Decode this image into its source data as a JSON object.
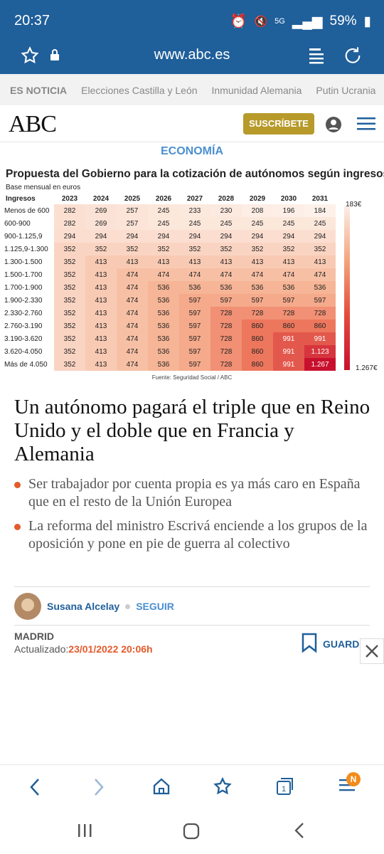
{
  "status_bar": {
    "time": "20:37",
    "battery": "59%",
    "network": "5G"
  },
  "browser": {
    "url": "www.abc.es"
  },
  "topics": [
    "ES NOTICIA",
    "Elecciones Castilla y León",
    "Inmunidad Alemania",
    "Putin Ucrania"
  ],
  "header": {
    "logo": "ABC",
    "subscribe_label": "SUSCRÍBETE"
  },
  "section": "ECONOMÍA",
  "chart_data": {
    "type": "table",
    "title": "Propuesta del Gobierno para la cotización de autónomos según ingresos",
    "subtitle": "Base mensual en euros",
    "row_header": "Ingresos",
    "columns": [
      "2023",
      "2024",
      "2025",
      "2026",
      "2027",
      "2028",
      "2029",
      "2030",
      "2031"
    ],
    "rows": [
      {
        "label": "Menos de 600",
        "values": [
          "282",
          "269",
          "257",
          "245",
          "233",
          "230",
          "208",
          "196",
          "184"
        ]
      },
      {
        "label": "600-900",
        "values": [
          "282",
          "269",
          "257",
          "245",
          "245",
          "245",
          "245",
          "245",
          "245"
        ]
      },
      {
        "label": "900-1.125,9",
        "values": [
          "294",
          "294",
          "294",
          "294",
          "294",
          "294",
          "294",
          "294",
          "294"
        ]
      },
      {
        "label": "1.125,9-1.300",
        "values": [
          "352",
          "352",
          "352",
          "352",
          "352",
          "352",
          "352",
          "352",
          "352"
        ]
      },
      {
        "label": "1.300-1.500",
        "values": [
          "352",
          "413",
          "413",
          "413",
          "413",
          "413",
          "413",
          "413",
          "413"
        ]
      },
      {
        "label": "1.500-1.700",
        "values": [
          "352",
          "413",
          "474",
          "474",
          "474",
          "474",
          "474",
          "474",
          "474"
        ]
      },
      {
        "label": "1.700-1.900",
        "values": [
          "352",
          "413",
          "474",
          "536",
          "536",
          "536",
          "536",
          "536",
          "536"
        ]
      },
      {
        "label": "1.900-2.330",
        "values": [
          "352",
          "413",
          "474",
          "536",
          "597",
          "597",
          "597",
          "597",
          "597"
        ]
      },
      {
        "label": "2.330-2.760",
        "values": [
          "352",
          "413",
          "474",
          "536",
          "597",
          "728",
          "728",
          "728",
          "728"
        ]
      },
      {
        "label": "2.760-3.190",
        "values": [
          "352",
          "413",
          "474",
          "536",
          "597",
          "728",
          "860",
          "860",
          "860"
        ]
      },
      {
        "label": "3.190-3.620",
        "values": [
          "352",
          "413",
          "474",
          "536",
          "597",
          "728",
          "860",
          "991",
          "991"
        ]
      },
      {
        "label": "3.620-4.050",
        "values": [
          "352",
          "413",
          "474",
          "536",
          "597",
          "728",
          "860",
          "991",
          "1.123"
        ]
      },
      {
        "label": "Más de 4.050",
        "values": [
          "352",
          "413",
          "474",
          "536",
          "597",
          "728",
          "860",
          "991",
          "1.267"
        ]
      }
    ],
    "legend_min": "183€",
    "legend_max": "1.267€",
    "source": "Fuente: Seguridad Social / ABC",
    "colors": {
      "low": "#fdf1ea",
      "high": "#c8102e"
    }
  },
  "article": {
    "headline": "Un autónomo pagará el triple que en Reino Unido y el doble que en Francia y Alemania",
    "bullets": [
      "Ser trabajador por cuenta propia es ya más caro en España que en el resto de la Unión Europea",
      "La reforma del ministro Escrivá enciende a los grupos de la oposición y pone en pie de guerra al colectivo"
    ],
    "author": "Susana Alcelay",
    "follow_label": "SEGUIR",
    "city": "MADRID",
    "updated_label": "Actualizado:",
    "updated_date": "23/01/2022 20:06h",
    "save_label": "GUARDA"
  },
  "bottom_nav": {
    "badge": "N"
  },
  "colors": {
    "brand_blue": "#1f5f9a",
    "accent_orange": "#e35a2b",
    "gold": "#b79a2a"
  }
}
